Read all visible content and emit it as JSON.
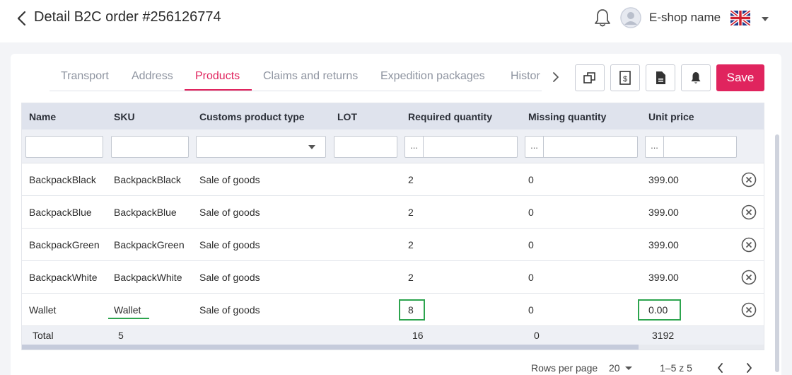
{
  "header": {
    "title": "Detail B2C order #256126774",
    "shop_name": "E-shop name"
  },
  "tabs": [
    "Transport",
    "Address",
    "Products",
    "Claims and returns",
    "Expedition packages",
    "Histor"
  ],
  "active_tab": "Products",
  "toolbar": {
    "save_label": "Save"
  },
  "table": {
    "columns": [
      "Name",
      "SKU",
      "Customs product type",
      "LOT",
      "Required quantity",
      "Missing quantity",
      "Unit price"
    ],
    "filter_dots": "...",
    "rows": [
      {
        "name": "BackpackBlack",
        "sku": "BackpackBlack",
        "type": "Sale of goods",
        "lot": "",
        "required": "2",
        "missing": "0",
        "price": "399.00"
      },
      {
        "name": "BackpackBlue",
        "sku": "BackpackBlue",
        "type": "Sale of goods",
        "lot": "",
        "required": "2",
        "missing": "0",
        "price": "399.00"
      },
      {
        "name": "BackpackGreen",
        "sku": "BackpackGreen",
        "type": "Sale of goods",
        "lot": "",
        "required": "2",
        "missing": "0",
        "price": "399.00"
      },
      {
        "name": "BackpackWhite",
        "sku": "BackpackWhite",
        "type": "Sale of goods",
        "lot": "",
        "required": "2",
        "missing": "0",
        "price": "399.00"
      },
      {
        "name": "Wallet",
        "sku": "Wallet",
        "type": "Sale of goods",
        "lot": "",
        "required": "8",
        "missing": "0",
        "price": "0.00"
      }
    ],
    "total": {
      "label": "Total",
      "sku": "5",
      "required": "16",
      "missing": "0",
      "price": "3192"
    }
  },
  "pagination": {
    "rows_per_page_label": "Rows per page",
    "rows_per_page": "20",
    "range": "1–5 z 5"
  },
  "colors": {
    "accent": "#e0245e",
    "highlight": "#2da44e",
    "header_bg": "#dfe3ed"
  }
}
